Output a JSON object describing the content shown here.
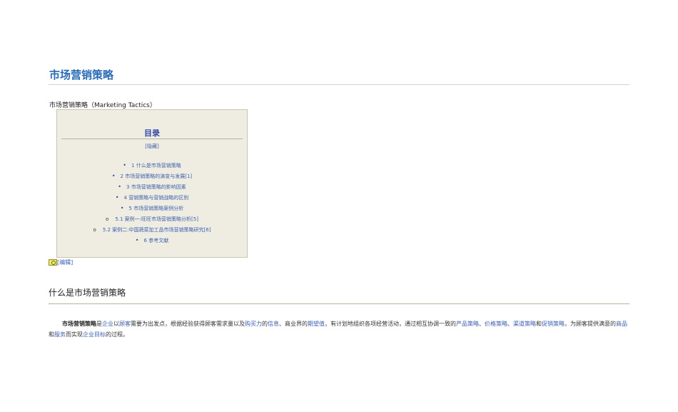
{
  "page": {
    "title": "市场营销策略",
    "subtitle": "市场营销策略（Marketing Tactics）"
  },
  "toc": {
    "title": "目录",
    "hide_label": "[隐藏]",
    "items": [
      {
        "level": 1,
        "label": "1 什么是市场营销策略"
      },
      {
        "level": 1,
        "label": "2 市场营销策略的演变与发展[1]"
      },
      {
        "level": 1,
        "label": "3 市场营销策略的影响因素"
      },
      {
        "level": 1,
        "label": "4 营销策略与营销战略的区别"
      },
      {
        "level": 1,
        "label": "5 市场营销策略案例分析"
      },
      {
        "level": 2,
        "label": "5.1 案例一:旺旺市场营销策略分析[5]"
      },
      {
        "level": 2,
        "label": "5.2 案例二:中国蔬菜加工品市场营销策略研究[6]"
      },
      {
        "level": 1,
        "label": "6 参考文献"
      }
    ],
    "bullet_symbol": "•",
    "sub_bullet_symbol": "o"
  },
  "edit": {
    "label": "[编辑]",
    "icon": "edit-icon"
  },
  "section": {
    "title": "什么是市场营销策略",
    "paragraph": [
      {
        "t": "市场营销策略",
        "k": "bold"
      },
      {
        "t": "是"
      },
      {
        "t": "企业",
        "k": "link"
      },
      {
        "t": "以"
      },
      {
        "t": "顾客",
        "k": "link"
      },
      {
        "t": "需要为出发点，根据经验获得顾客需求量以及"
      },
      {
        "t": "购买力",
        "k": "link"
      },
      {
        "t": "的"
      },
      {
        "t": "信息",
        "k": "link"
      },
      {
        "t": "、商业界的"
      },
      {
        "t": "期望值",
        "k": "link"
      },
      {
        "t": "，有计划地组织各项经营活动，通过相互协调一致的"
      },
      {
        "t": "产品策略",
        "k": "link"
      },
      {
        "t": "、"
      },
      {
        "t": "价格策略",
        "k": "link"
      },
      {
        "t": "、"
      },
      {
        "t": "渠道策略",
        "k": "link"
      },
      {
        "t": "和"
      },
      {
        "t": "促销策略",
        "k": "link"
      },
      {
        "t": "，为顾客提供满意的"
      },
      {
        "t": "商品",
        "k": "link"
      },
      {
        "t": "和"
      },
      {
        "t": "服务",
        "k": "link"
      },
      {
        "t": "而实现"
      },
      {
        "t": "企业目标",
        "k": "link"
      },
      {
        "t": "的过程。"
      }
    ]
  },
  "colors": {
    "title_blue": "#2a6bb5",
    "link_blue": "#3d5fb0",
    "toc_bg": "#efede2"
  }
}
